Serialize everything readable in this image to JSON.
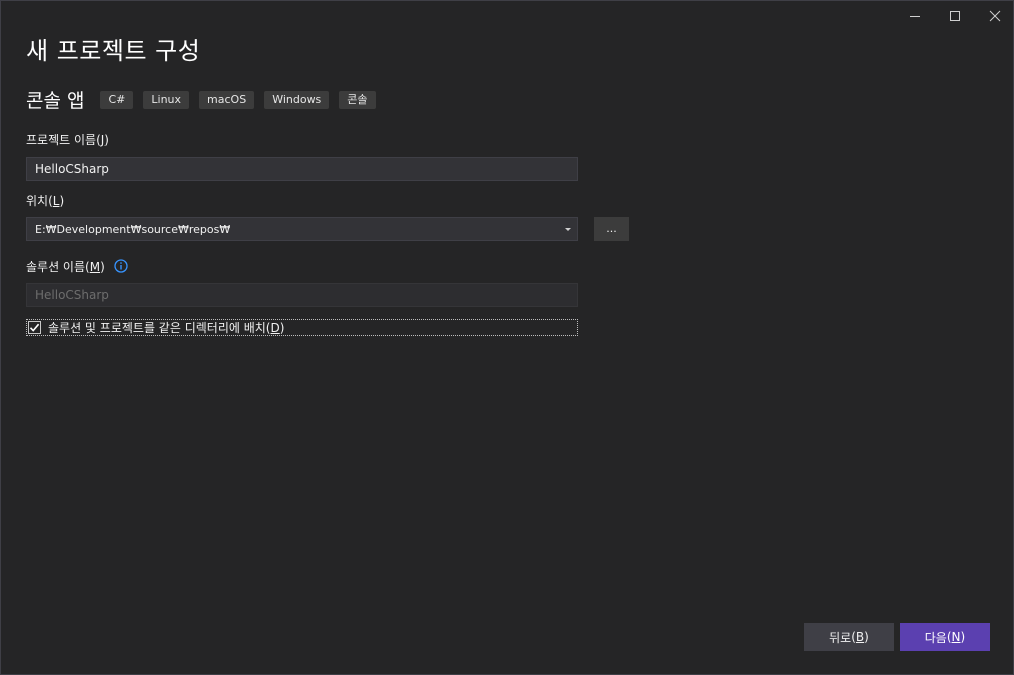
{
  "window": {
    "controls": {
      "minimize_icon": "minimize-icon",
      "maximize_icon": "maximize-icon",
      "close_icon": "close-icon"
    }
  },
  "header": {
    "title": "새 프로젝트 구성",
    "template_name": "콘솔 앱",
    "tags": [
      "C#",
      "Linux",
      "macOS",
      "Windows",
      "콘솔"
    ]
  },
  "form": {
    "project_name": {
      "label": "프로젝트 이름",
      "access_key": "J",
      "value": "HelloCSharp"
    },
    "location": {
      "label": "위치",
      "access_key": "L",
      "value": "E:₩Development₩source₩repos₩",
      "browse_label": "..."
    },
    "solution_name": {
      "label": "솔루션 이름",
      "access_key": "M",
      "value": "HelloCSharp",
      "info_icon": "info-icon"
    },
    "same_directory": {
      "label": "솔루션 및 프로젝트를 같은 디렉터리에 배치",
      "access_key": "D",
      "checked": true
    }
  },
  "footer": {
    "back": {
      "label": "뒤로",
      "access_key": "B"
    },
    "next": {
      "label": "다음",
      "access_key": "N"
    }
  },
  "colors": {
    "background": "#252526",
    "accent": "#5b40b0",
    "info": "#3794ff"
  }
}
